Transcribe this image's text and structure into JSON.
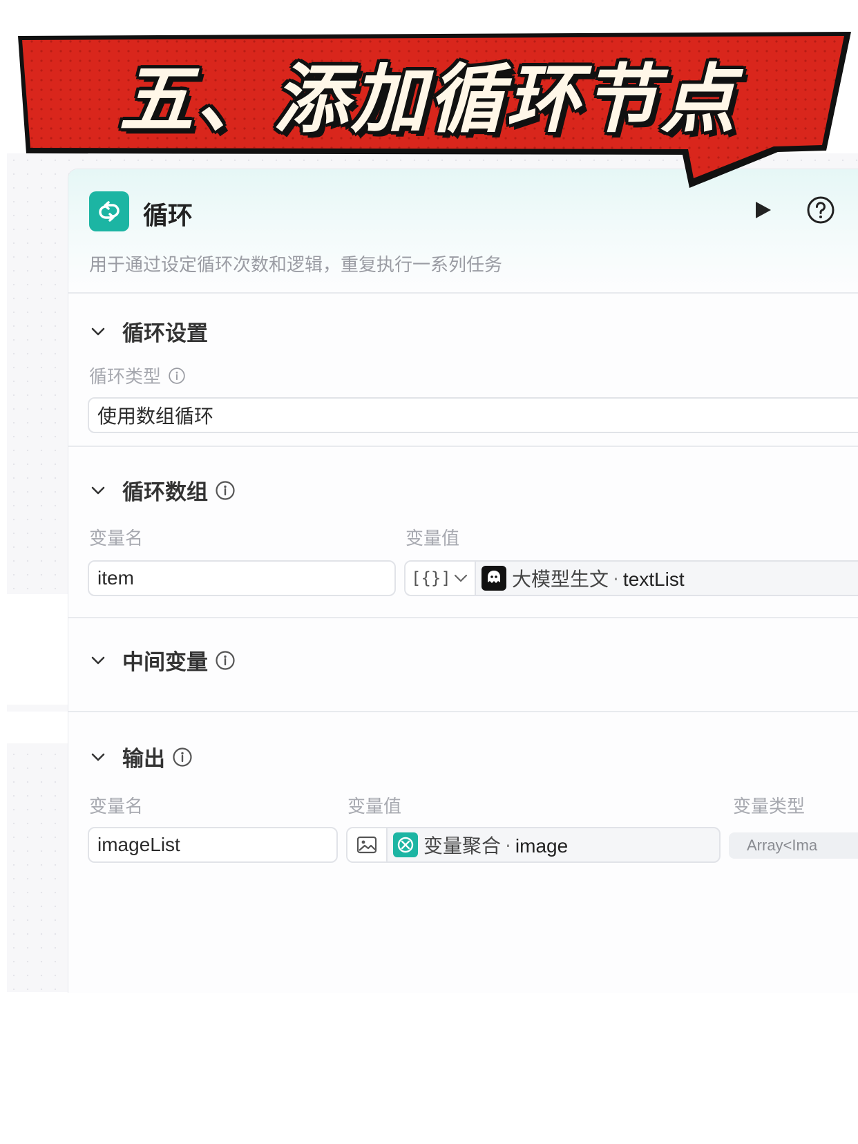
{
  "banner": {
    "title": "五、添加循环节点",
    "bg_color": "#d9261c"
  },
  "node": {
    "title": "循环",
    "description": "用于通过设定循环次数和逻辑，重复执行一系列任务",
    "icon": "loop-icon",
    "accent_color": "#1cb5a3",
    "run_icon": "play-icon",
    "help_icon": "question-circle-icon"
  },
  "loop_settings": {
    "heading": "循环设置",
    "type_label": "循环类型",
    "type_value": "使用数组循环"
  },
  "loop_array": {
    "heading": "循环数组",
    "col_name": "变量名",
    "col_value": "变量值",
    "var_name": "item",
    "ref_type_symbol": "[{}]",
    "ref_source": "大模型生文",
    "ref_separator": "·",
    "ref_variable": "textList"
  },
  "intermediate": {
    "heading": "中间变量"
  },
  "output": {
    "heading": "输出",
    "col_name": "变量名",
    "col_value": "变量值",
    "col_type": "变量类型",
    "var_name": "imageList",
    "ref_source": "变量聚合",
    "ref_separator": "·",
    "ref_variable": "image",
    "var_type": "Array<Ima"
  }
}
